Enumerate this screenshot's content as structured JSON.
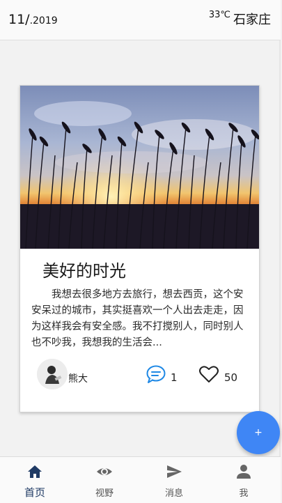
{
  "header": {
    "date_day_month": "11/",
    "date_year": ".2019",
    "temperature": "33℃",
    "city": "石家庄"
  },
  "card": {
    "title": "美好的时光",
    "text": "我想去很多地方去旅行，想去西贡，这个安安呆过的城市，其实挺喜欢一个人出去走走，因为这样我会有安全感。我不打搅别人，同时别人也不吵我，我想我的生活会...",
    "author": "熊大",
    "comment_count": "1",
    "like_count": "50"
  },
  "fab": {
    "label": "+"
  },
  "nav": {
    "items": [
      {
        "label": "首页",
        "icon": "home-icon",
        "active": true
      },
      {
        "label": "视野",
        "icon": "eye-icon",
        "active": false
      },
      {
        "label": "消息",
        "icon": "send-icon",
        "active": false
      },
      {
        "label": "我",
        "icon": "person-icon",
        "active": false
      }
    ]
  },
  "colors": {
    "accent": "#3f86f5",
    "nav_active": "#1f3a64",
    "nav_inactive": "#666666",
    "comment_icon": "#1e88e5"
  }
}
